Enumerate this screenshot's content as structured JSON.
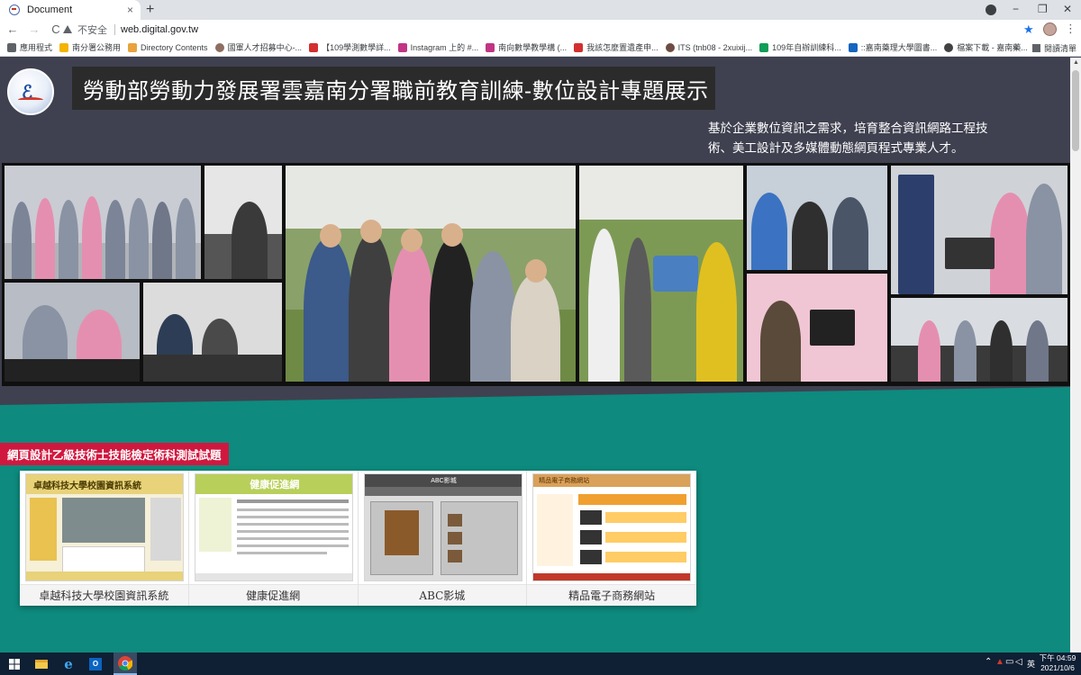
{
  "browser": {
    "tab_title": "Document",
    "tab_close": "×",
    "new_tab": "+",
    "minimize": "−",
    "maximize": "❐",
    "close": "✕",
    "back": "←",
    "forward": "→",
    "reload": "C",
    "security_label": "不安全",
    "url": "web.digital.gov.tw",
    "star": "★",
    "menu": "⋮",
    "bookmarks": [
      {
        "label": "應用程式",
        "color": "#5f6368"
      },
      {
        "label": "南分署公務用",
        "color": "#f4b400"
      },
      {
        "label": "Directory Contents",
        "color": "#e8a33d"
      },
      {
        "label": "國軍人才招募中心-...",
        "color": "#8d6e63"
      },
      {
        "label": "【109學測數學詳...",
        "color": "#d32f2f"
      },
      {
        "label": "Instagram 上的 #...",
        "color": "#c13584"
      },
      {
        "label": "南向數學教學構 (...",
        "color": "#c13584"
      },
      {
        "label": "我該怎麼置遺產申...",
        "color": "#d32f2f"
      },
      {
        "label": "ITS (tnb08 - 2xuixij...",
        "color": "#6d4c41"
      },
      {
        "label": "109年自辦訓練科...",
        "color": "#0f9d58"
      },
      {
        "label": "::嘉南藥理大學圖書...",
        "color": "#1565c0"
      },
      {
        "label": "檔案下載 - 嘉南藥...",
        "color": "#424242"
      }
    ],
    "bookmarks_more": "»",
    "reading_list": "閱讀清單"
  },
  "page": {
    "title": "勞動部勞動力發展署雲嘉南分署職前教育訓練-數位設計專題展示",
    "intro": "基於企業數位資訊之需求，培育整合資訊網路工程技術、美工設計及多媒體動態網頁程式專業人才。",
    "section_title": "網頁設計乙級技術士技能檢定術科測試試題",
    "cards": [
      {
        "label": "卓越科技大學校園資訊系統",
        "thumb_header": "卓越科技大學校園資訊系統"
      },
      {
        "label": "健康促進網",
        "thumb_header": "健康促進網"
      },
      {
        "label": "ABC影城",
        "thumb_header": "ABC影城"
      },
      {
        "label": "精品電子商務網站",
        "thumb_header": "精品電子商務網站"
      }
    ]
  },
  "taskbar": {
    "time": "下午 04:59",
    "date": "2021/10/6",
    "ime": "英"
  },
  "colors": {
    "page_bg": "#3f4150",
    "teal": "#0e8a7e",
    "section_tag": "#d0183f",
    "title_box": "#2b2b2b"
  }
}
